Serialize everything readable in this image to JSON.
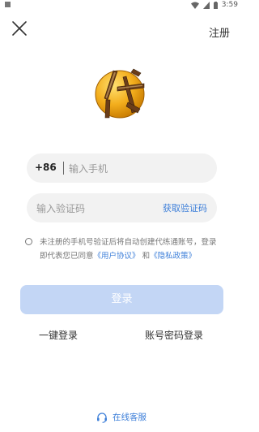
{
  "status_bar": {
    "time": "3:59"
  },
  "header": {
    "register_label": "注册"
  },
  "phone": {
    "prefix": "+86",
    "placeholder": "输入手机"
  },
  "code": {
    "placeholder": "输入验证码",
    "get_code_label": "获取验证码"
  },
  "agreement": {
    "text_before": "未注册的手机号验证后将自动创建代练通账号，登录即代表您已同意",
    "user_agreement": "《用户协议》",
    "and": "和",
    "privacy_policy": "《隐私政策》"
  },
  "login": {
    "button_label": "登录",
    "one_click_label": "一键登录",
    "account_password_label": "账号密码登录"
  },
  "footer": {
    "service_label": "在线客服"
  },
  "colors": {
    "accent": "#3d7fd9",
    "login_button": "#c3d6f5",
    "logo_gold": "#f0a818"
  }
}
